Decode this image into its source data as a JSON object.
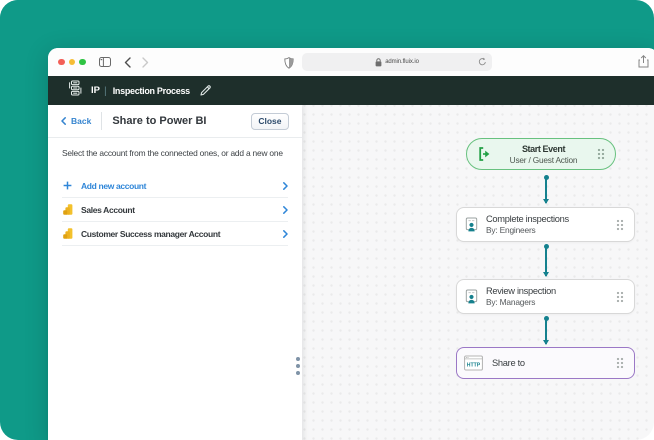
{
  "browser": {
    "url": "admin.fluix.io",
    "traffic_lights": {
      "close": "#f35f57",
      "minimize": "#f6bd35",
      "zoom": "#2fc443"
    },
    "icons": [
      "sidebar-toggle",
      "back-arrow",
      "forward-arrow",
      "privacy-shield",
      "lock",
      "reload",
      "share"
    ]
  },
  "app_header": {
    "initials": "IP",
    "divider": "|",
    "title": "Inspection Process",
    "background": "#1e2f2b"
  },
  "panel": {
    "back_label": "Back",
    "title": "Share to Power BI",
    "close_label": "Close",
    "message": "Select the account from the connected ones, or add a new one",
    "add_account_label": "Add new account",
    "accounts": [
      {
        "label": "Sales Account",
        "icon": "power-bi"
      },
      {
        "label": "Customer Success manager Account",
        "icon": "power-bi"
      }
    ],
    "accent_blue": "#2f86d8"
  },
  "canvas": {
    "background": "#f7f7f8",
    "connector_color": "#14818e",
    "nodes": [
      {
        "type": "start-event",
        "title": "Start Event",
        "subtitle": "User / Guest Action",
        "border": "#68c17f",
        "fill": "#e9f7ee"
      },
      {
        "type": "task",
        "title": "Complete inspections",
        "subtitle": "By: Engineers"
      },
      {
        "type": "task",
        "title": "Review inspection",
        "subtitle": "By: Managers"
      },
      {
        "type": "integration",
        "title": "Share to",
        "badge": "HTTP",
        "border": "#9b78c6"
      }
    ]
  },
  "frame": {
    "background": "#0f9a88"
  }
}
